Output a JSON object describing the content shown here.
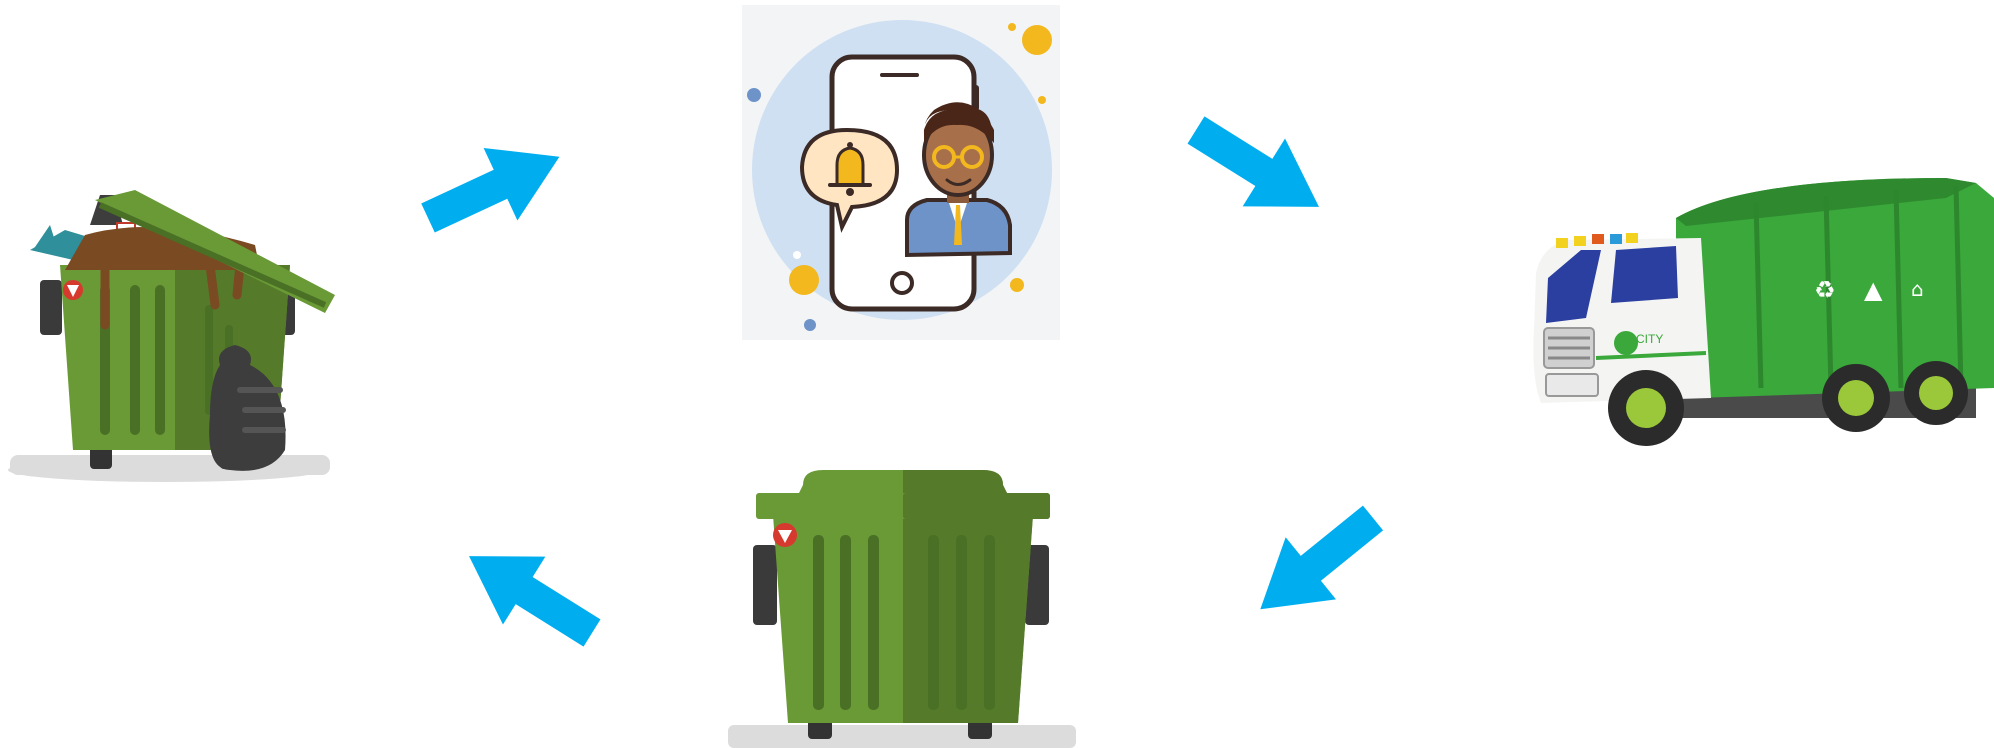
{
  "diagram": {
    "type": "cycle",
    "nodes": [
      {
        "id": "full-bin",
        "icon": "overflowing-dumpster-icon"
      },
      {
        "id": "notification",
        "icon": "phone-notification-icon"
      },
      {
        "id": "truck",
        "icon": "garbage-truck-icon",
        "truck_label": "CITY"
      },
      {
        "id": "empty-bin",
        "icon": "empty-dumpster-icon"
      }
    ],
    "edges": [
      {
        "from": "full-bin",
        "to": "notification"
      },
      {
        "from": "notification",
        "to": "truck"
      },
      {
        "from": "truck",
        "to": "empty-bin"
      },
      {
        "from": "empty-bin",
        "to": "full-bin"
      }
    ]
  },
  "colors": {
    "arrow": "#00aeef",
    "bin_light": "#6a9a36",
    "bin_dark": "#557a2a",
    "truck_green": "#3aa83a",
    "phone_circle": "#cfe0f3",
    "bell": "#f2b81e"
  }
}
